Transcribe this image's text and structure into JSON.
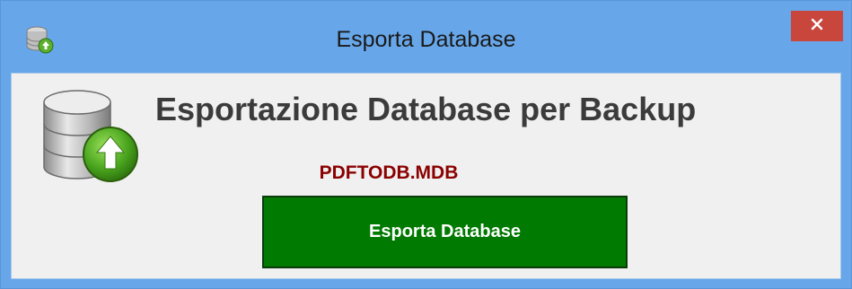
{
  "window": {
    "title": "Esporta Database",
    "app_icon": "database-icon",
    "close_icon": "close-icon"
  },
  "content": {
    "heading": "Esportazione Database per Backup",
    "filename": "PDFTODB.MDB",
    "export_button_label": "Esporta Database",
    "illustration_icon": "database-export-icon"
  },
  "colors": {
    "titlebar": "#67a7e9",
    "close_button": "#c9463d",
    "client_background": "#f0f0f0",
    "filename_text": "#8b0000",
    "export_button": "#007a00"
  }
}
